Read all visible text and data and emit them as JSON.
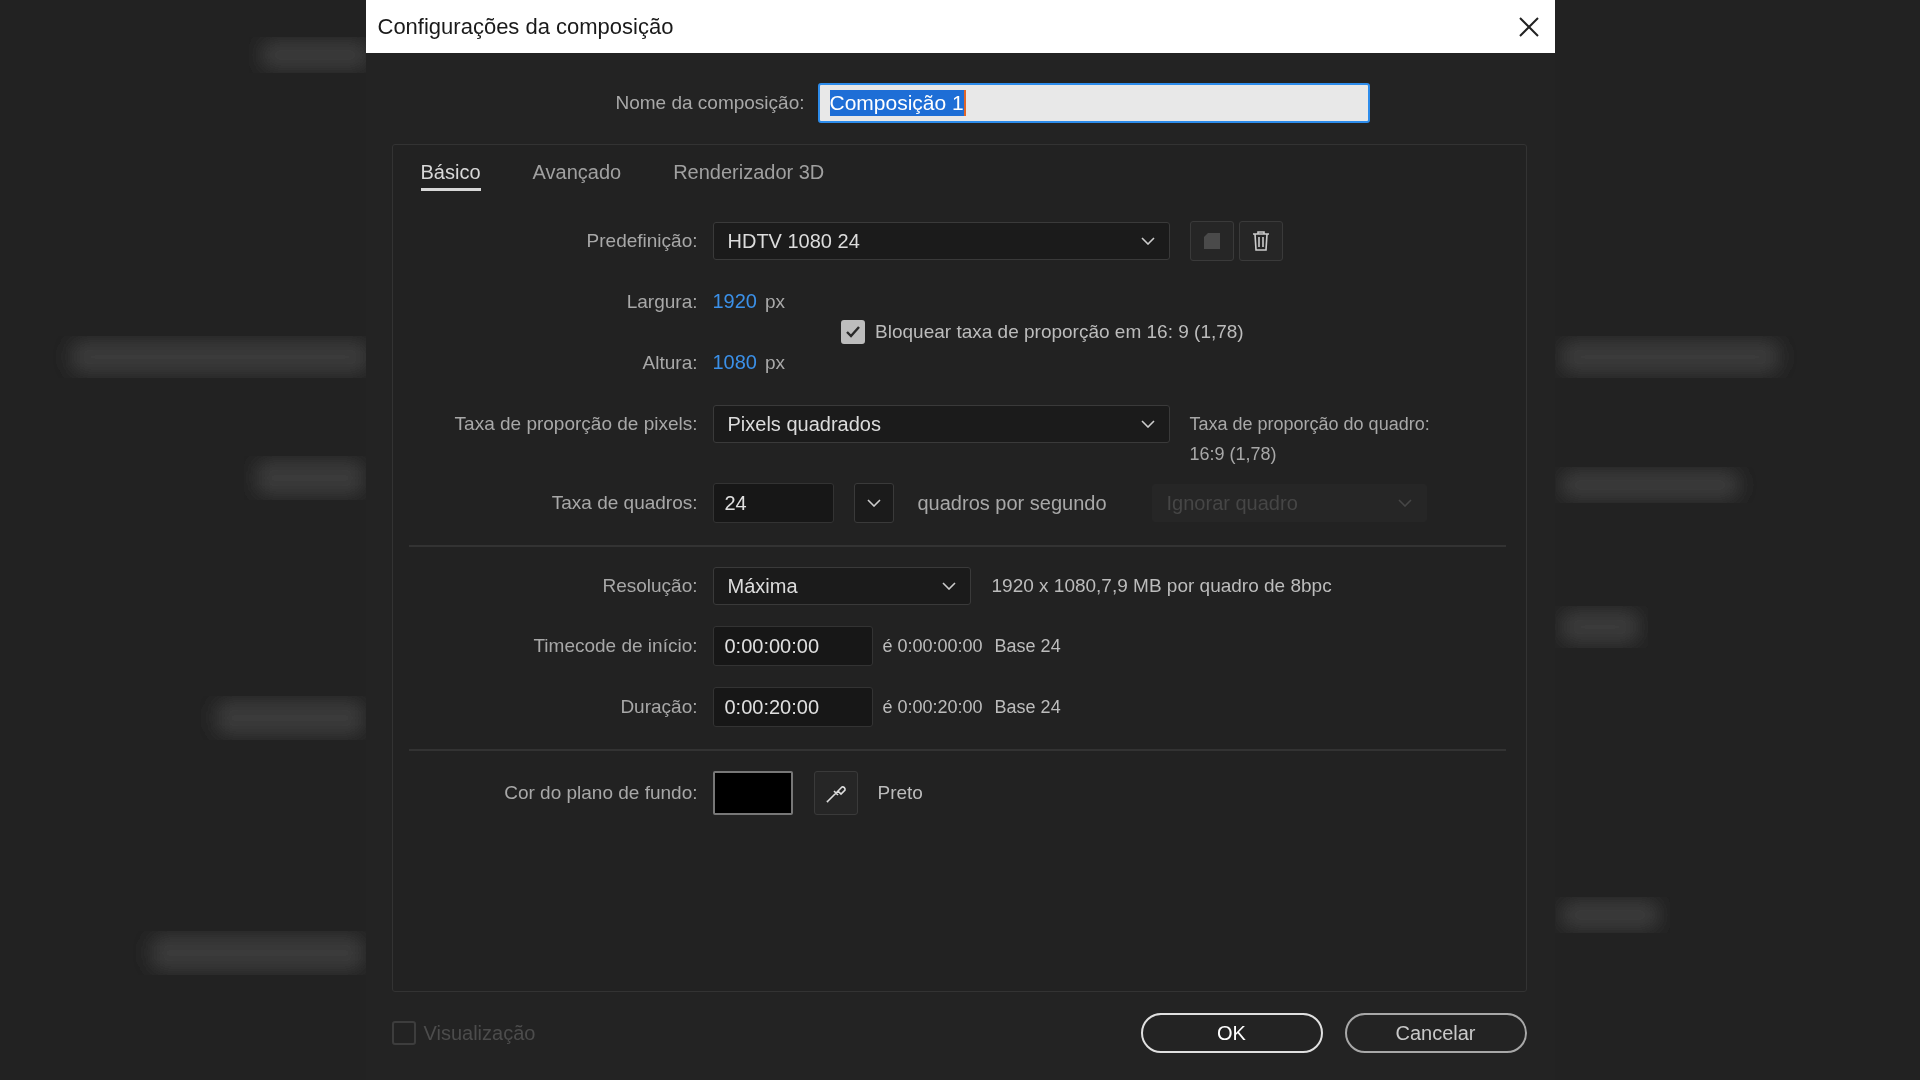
{
  "dialog": {
    "title": "Configurações da composição"
  },
  "name_field": {
    "label": "Nome da composição:",
    "value": "Composição 1"
  },
  "tabs": [
    {
      "label": "Básico",
      "selected": true
    },
    {
      "label": "Avançado",
      "selected": false
    },
    {
      "label": "Renderizador 3D",
      "selected": false
    }
  ],
  "preset": {
    "label": "Predefinição:",
    "value": "HDTV 1080 24"
  },
  "width": {
    "label": "Largura:",
    "value": "1920",
    "unit": "px"
  },
  "height": {
    "label": "Altura:",
    "value": "1080",
    "unit": "px"
  },
  "lock_aspect": {
    "label": "Bloquear taxa de proporção em 16: 9 (1,78)",
    "checked": true
  },
  "pixel_aspect": {
    "label": "Taxa de proporção de pixels:",
    "value": "Pixels quadrados"
  },
  "frame_aspect": [
    "Taxa de proporção do quadro:",
    "16:9 (1,78)"
  ],
  "frame_rate": {
    "label": "Taxa de quadros:",
    "value": "24",
    "unit": "quadros por segundo",
    "drop_frame": {
      "value": "Ignorar quadro",
      "disabled": true
    }
  },
  "resolution": {
    "label": "Resolução:",
    "value": "Máxima",
    "info": "1920 x 1080,7,9 MB por quadro de 8bpc"
  },
  "start_timecode": {
    "label": "Timecode de início:",
    "value": "0:00:00:00",
    "equals": "é 0:00:00:00",
    "base": "Base 24"
  },
  "duration": {
    "label": "Duração:",
    "value": "0:00:20:00",
    "equals": "é 0:00:20:00",
    "base": "Base 24"
  },
  "background": {
    "label": "Cor do plano de fundo:",
    "color": "#000000",
    "name": "Preto"
  },
  "preview": {
    "label": "Visualização",
    "checked": false,
    "disabled": true
  },
  "buttons": [
    {
      "label": "OK",
      "kind": "primary"
    },
    {
      "label": "Cancelar",
      "kind": "secondary"
    }
  ]
}
